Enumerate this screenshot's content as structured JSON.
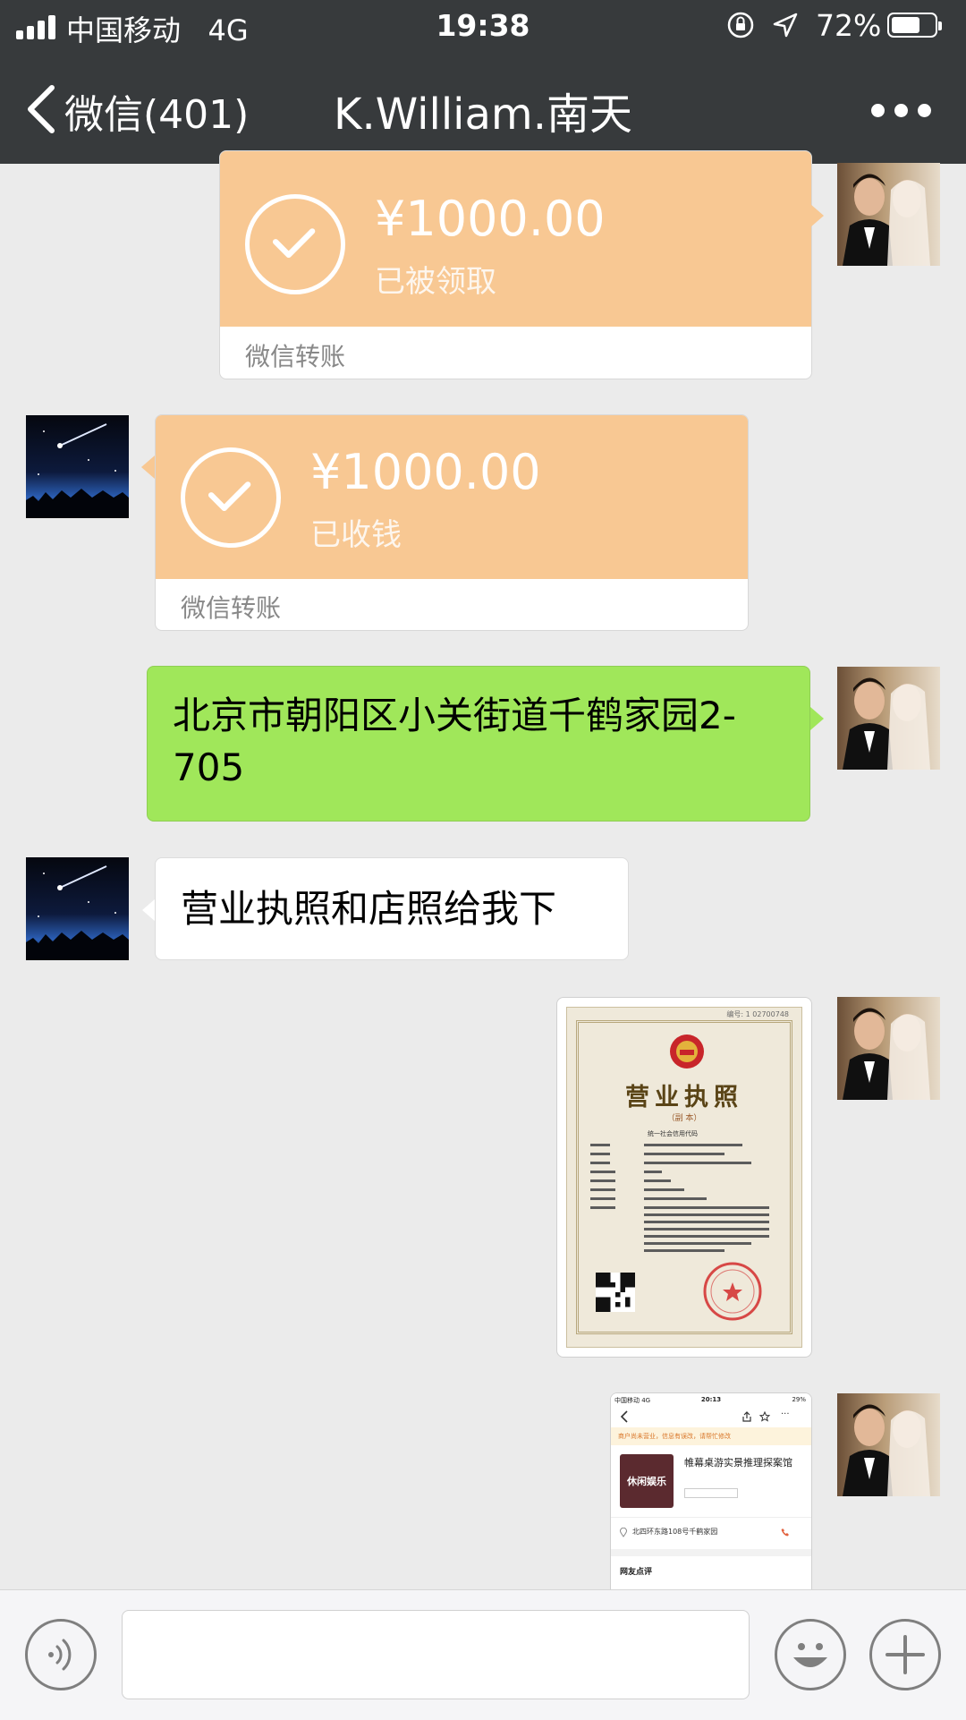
{
  "status_bar": {
    "carrier": "中国移动",
    "network": "4G",
    "time": "19:38",
    "battery": "72%",
    "battery_level": 0.72
  },
  "nav": {
    "back_label": "微信(401)",
    "title": "K.William.南天"
  },
  "messages": [
    {
      "type": "transfer",
      "side": "right",
      "amount": "¥1000.00",
      "status": "已被领取",
      "footer": "微信转账"
    },
    {
      "type": "transfer",
      "side": "left",
      "amount": "¥1000.00",
      "status": "已收钱",
      "footer": "微信转账"
    },
    {
      "type": "text",
      "side": "right",
      "text": "北京市朝阳区小关街道千鹤家园2-705"
    },
    {
      "type": "text",
      "side": "left",
      "text": "营业执照和店照给我下"
    },
    {
      "type": "image",
      "side": "right",
      "content": "business-license",
      "license": {
        "number": "编号: 1 02700748",
        "title": "营业执照",
        "copy": "（副 本）",
        "credit_code_label": "统一社会信用代码"
      }
    },
    {
      "type": "image",
      "side": "right",
      "content": "phone-screenshot",
      "shot": {
        "carrier": "中国移动 4G",
        "time": "20:13",
        "battery": "29%",
        "notice": "商户尚未营业，信息有误改，请帮忙修改",
        "thumb_label": "休闲娱乐",
        "shop_name": "帷幕桌游实景推理探案馆",
        "address": "北四环东路108号千鹤家园",
        "reviews_title": "网友点评"
      }
    }
  ],
  "colors": {
    "topbar": "#373a3c",
    "transfer_orange": "#f8c893",
    "my_bubble": "#a0e75a",
    "background": "#ebebeb"
  }
}
